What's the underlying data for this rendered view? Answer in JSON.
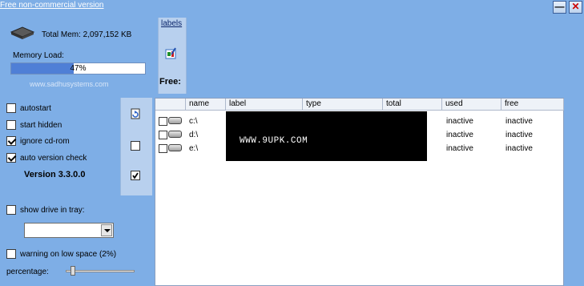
{
  "titlebar": {
    "version_link": "Free non-commercial version",
    "minimize": "—",
    "close": "✕"
  },
  "memory": {
    "total_mem": "Total Mem: 2,097,152 KB",
    "load_label": "Memory Load:",
    "load_value": 47,
    "load_text": "47%",
    "site": "www.sadhusystems.com"
  },
  "labels_panel": {
    "link": "labels",
    "free": "Free:"
  },
  "options": [
    {
      "label": "autostart",
      "checked": false
    },
    {
      "label": "start hidden",
      "checked": false
    },
    {
      "label": "ignore cd-rom",
      "checked": true
    },
    {
      "label": "auto version check",
      "checked": true
    }
  ],
  "version": "Version 3.3.0.0",
  "tray": {
    "label": "show drive in tray:",
    "checked": false,
    "selected": ""
  },
  "low_space": {
    "label": "warning on low space (2%)",
    "checked": false,
    "percentage_label": "percentage:",
    "percentage_value": 2
  },
  "table": {
    "columns": [
      "name",
      "label",
      "type",
      "total",
      "used",
      "free"
    ],
    "rows": [
      {
        "name": "c:\\",
        "label": "",
        "type": "",
        "total": "",
        "used": "inactive",
        "free": "inactive"
      },
      {
        "name": "d:\\",
        "label": "",
        "type": "",
        "total": "",
        "used": "inactive",
        "free": "inactive"
      },
      {
        "name": "e:\\",
        "label": "",
        "type": "",
        "total": "",
        "used": "inactive",
        "free": "inactive"
      }
    ]
  },
  "watermark": "WWW.9UPK.COM",
  "colors": {
    "background": "#7eaee6",
    "panel": "#b8d0ee",
    "bar_fill": "#4f7fd6"
  }
}
